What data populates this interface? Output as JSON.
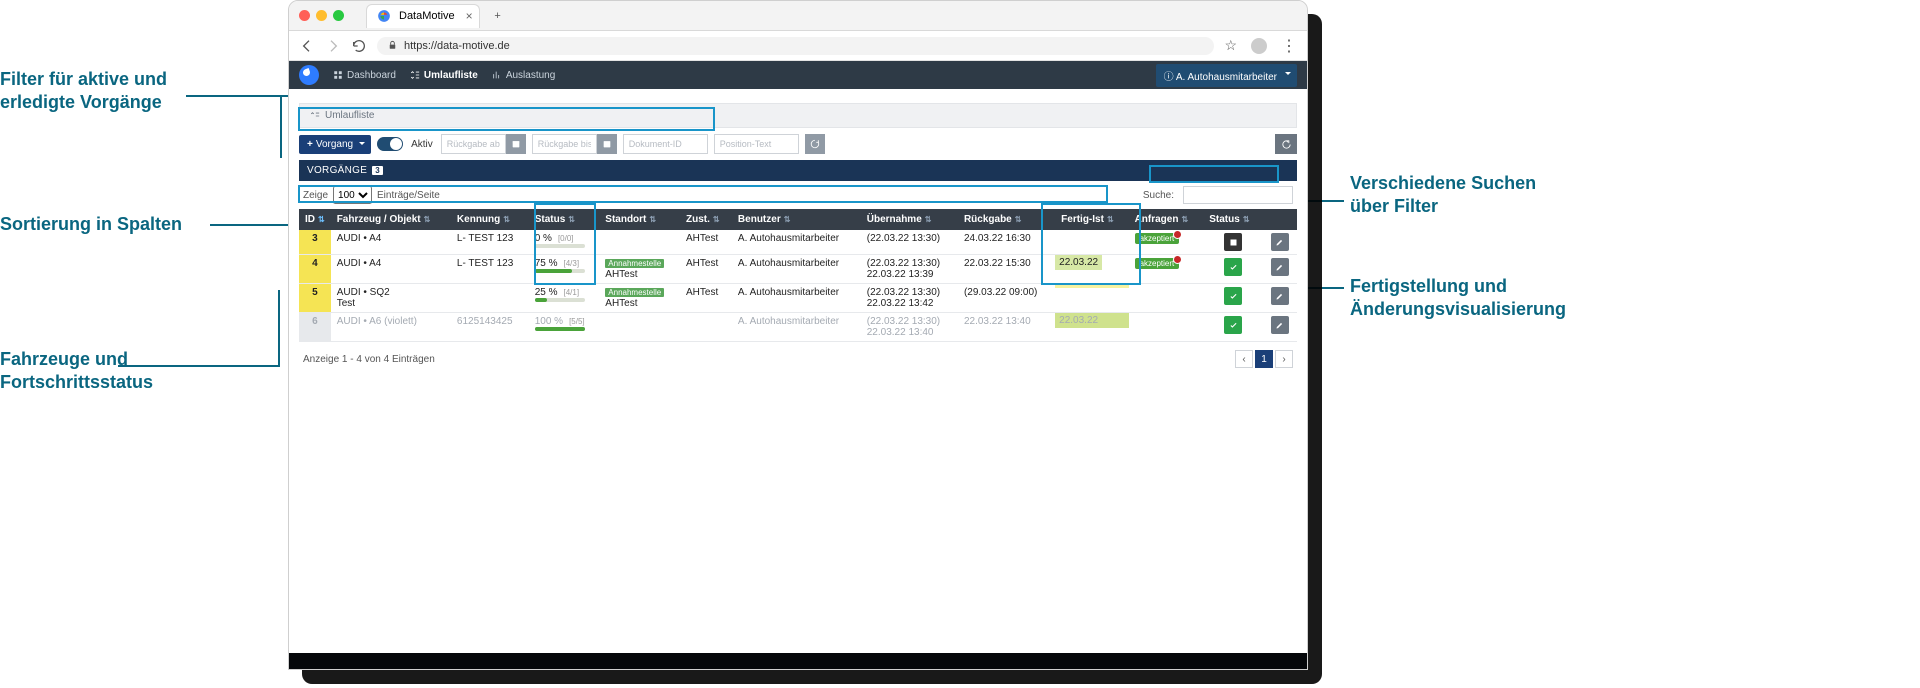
{
  "browser": {
    "tab_title": "DataMotive",
    "url": "https://data-motive.de"
  },
  "appnav": {
    "items": [
      {
        "icon": "dashboard-icon",
        "label": "Dashboard"
      },
      {
        "icon": "list-icon",
        "label": "Umlaufliste",
        "active": true
      },
      {
        "icon": "chart-icon",
        "label": "Auslastung"
      }
    ],
    "user_label": "A. Autohausmitarbeiter"
  },
  "breadcrumb": {
    "label": "Umlaufliste"
  },
  "filter": {
    "new_btn": "Vorgang",
    "toggle_label": "Aktiv",
    "from_ph": "Rückgabe ab",
    "to_ph": "Rückgabe bis",
    "doc_ph": "Dokument-ID",
    "pos_ph": "Position-Text"
  },
  "panel": {
    "title": "VORGÄNGE",
    "badge": "3",
    "show_label": "Zeige",
    "page_size": "100",
    "entries_label": "Einträge/Seite",
    "search_label": "Suche:"
  },
  "columns": [
    "ID",
    "Fahrzeug / Objekt",
    "Kennung",
    "Status",
    "Standort",
    "Zust.",
    "Benutzer",
    "Übernahme",
    "Rückgabe",
    "Fertig-Ist",
    "Anfragen",
    "Status",
    ""
  ],
  "rows": [
    {
      "id": "3",
      "id_hl": "yellow",
      "fahrzeug": "AUDI • A4",
      "kennung": "L- TEST 123",
      "pct": "0 %",
      "pct_n": "[0/0]",
      "pct_w": 0,
      "standort_tag": "",
      "standort": "",
      "zust": "AHTest",
      "benutzer": "A. Autohausmitarbeiter",
      "uebernahme": "(22.03.22 13:30)",
      "rueckgabe": "24.03.22 16:30",
      "fertig": "",
      "fertig_hl": "",
      "anfrage": "akzeptiert",
      "anfrage_dot": true,
      "status_icon": "dark",
      "muted": false
    },
    {
      "id": "4",
      "id_hl": "yellow",
      "fahrzeug": "AUDI • A4",
      "kennung": "L- TEST 123",
      "pct": "75 %",
      "pct_n": "[4/3]",
      "pct_w": 75,
      "standort_tag": "Annahmestelle",
      "standort": "AHTest",
      "zust": "AHTest",
      "benutzer": "A. Autohausmitarbeiter",
      "uebernahme": "(22.03.22 13:30)\n22.03.22 13:39",
      "rueckgabe": "22.03.22 15:30",
      "fertig": "22.03.22",
      "fertig_hl": "green",
      "anfrage": "akzeptiert",
      "anfrage_dot": true,
      "status_icon": "green",
      "muted": false
    },
    {
      "id": "5",
      "id_hl": "yellow",
      "fahrzeug": "AUDI • SQ2\nTest",
      "kennung": "",
      "pct": "25 %",
      "pct_n": "[4/1]",
      "pct_w": 25,
      "standort_tag": "Annahmestelle",
      "standort": "AHTest",
      "zust": "AHTest",
      "benutzer": "A. Autohausmitarbeiter",
      "uebernahme": "(22.03.22 13:30)\n22.03.22 13:42",
      "rueckgabe": "(29.03.22 09:00)",
      "fertig": "",
      "fertig_hl": "yellow",
      "anfrage": "",
      "anfrage_dot": false,
      "status_icon": "green",
      "muted": false
    },
    {
      "id": "6",
      "id_hl": "gray",
      "fahrzeug": "AUDI • A6 (violett)",
      "kennung": "6125143425",
      "pct": "100 %",
      "pct_n": "[5/5]",
      "pct_w": 100,
      "standort_tag": "",
      "standort": "",
      "zust": "",
      "benutzer": "A. Autohausmitarbeiter",
      "uebernahme": "(22.03.22 13:30)\n22.03.22 13:40",
      "rueckgabe": "22.03.22 13:40",
      "fertig": "22.03.22",
      "fertig_hl": "both",
      "anfrage": "",
      "anfrage_dot": false,
      "status_icon": "green",
      "muted": true
    }
  ],
  "footer": {
    "info": "Anzeige 1 - 4 von 4 Einträgen",
    "page": "1"
  },
  "callouts": {
    "c1": "Filter für aktive und\nerledigte Vorgänge",
    "c2": "Sortierung in Spalten",
    "c3": "Fahrzeuge und\nFortschrittsstatus",
    "c4": "Verschiedene Suchen\nüber Filter",
    "c5": "Fertigstellung und\nÄnderungsvisualisierung"
  }
}
